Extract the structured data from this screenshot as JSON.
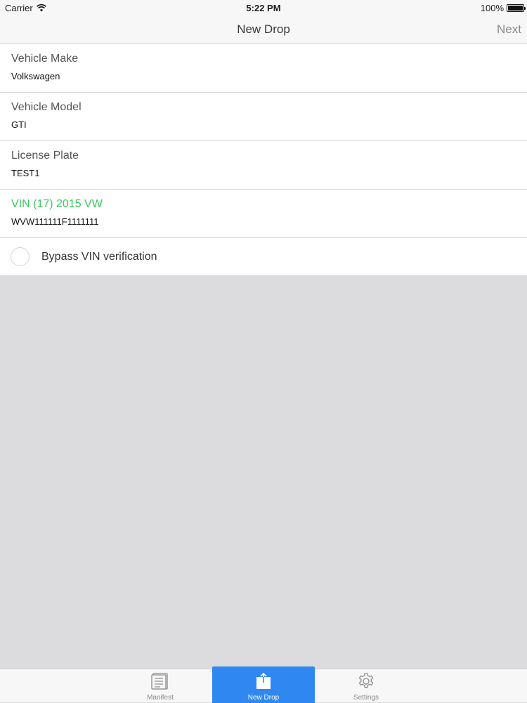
{
  "status_bar": {
    "carrier": "Carrier",
    "time": "5:22 PM",
    "battery": "100%"
  },
  "nav": {
    "title": "New Drop",
    "next_label": "Next"
  },
  "form": {
    "fields": [
      {
        "label": "Vehicle Make",
        "value": "Volkswagen"
      },
      {
        "label": "Vehicle Model",
        "value": "GTI"
      },
      {
        "label": "License Plate",
        "value": "TEST1"
      },
      {
        "label": "VIN (17) 2015 VW",
        "value": "WVW111111F1111111"
      }
    ],
    "bypass_label": "Bypass VIN verification",
    "vin_label_color": "#3cc85c"
  },
  "tabs": [
    {
      "label": "Manifest",
      "icon": "manifest-icon"
    },
    {
      "label": "New Drop",
      "icon": "upload-icon",
      "selected": true
    },
    {
      "label": "Settings",
      "icon": "gear-icon"
    }
  ],
  "colors": {
    "accent": "#2f88f2",
    "background": "#dcdcde"
  }
}
